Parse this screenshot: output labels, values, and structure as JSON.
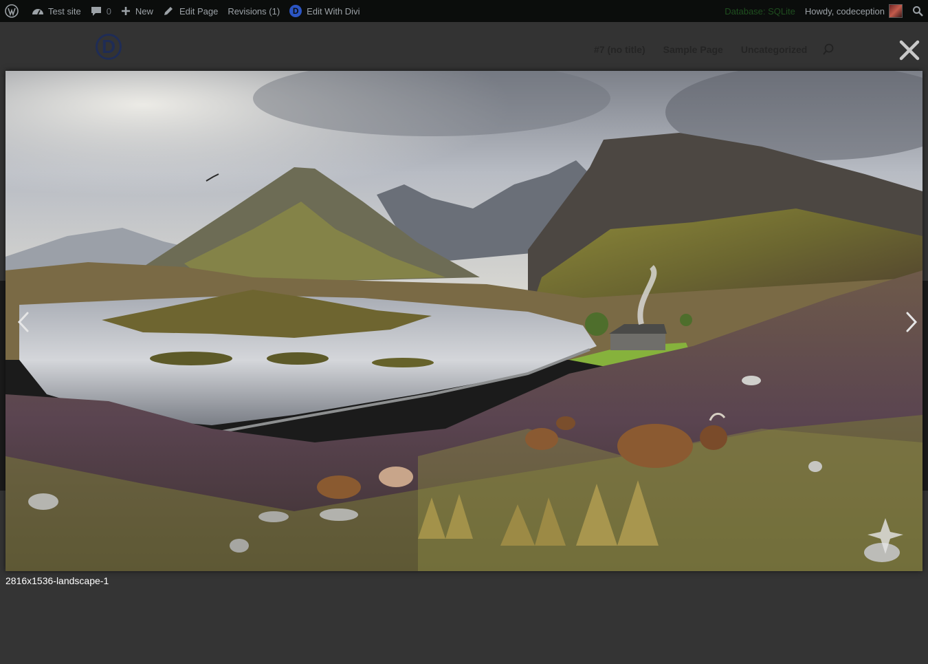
{
  "adminbar": {
    "site_name": "Test site",
    "comments_count": "0",
    "new_label": "New",
    "edit_page_label": "Edit Page",
    "revisions_label": "Revisions (1)",
    "divi_label": "Edit With Divi",
    "database_label": "Database: SQLite",
    "howdy_label": "Howdy, codeception"
  },
  "site": {
    "logo_letter": "D",
    "nav_items": [
      "#7 (no title)",
      "Sample Page",
      "Uncategorized"
    ]
  },
  "lightbox": {
    "caption": "2816x1536-landscape-1"
  },
  "colors": {
    "adminbar_bg": "#0b0d0c",
    "overlay_bg": "#3b3b3b",
    "caption_text": "#ffffff"
  }
}
